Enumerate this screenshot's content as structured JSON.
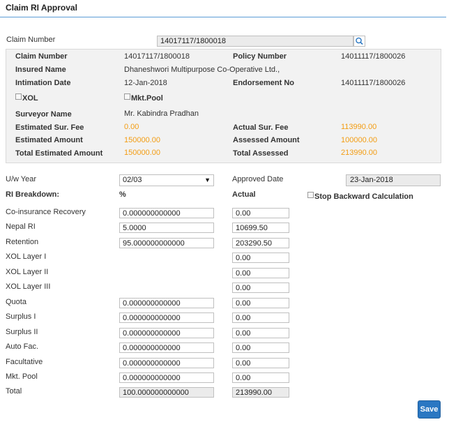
{
  "page": {
    "title": "Claim RI Approval"
  },
  "claim_search": {
    "label": "Claim Number",
    "value": "14017117/1800018"
  },
  "details": {
    "claim_number_label": "Claim Number",
    "claim_number": "14017117/1800018",
    "policy_number_label": "Policy Number",
    "policy_number": "14011117/1800026",
    "insured_name_label": "Insured Name",
    "insured_name": "Dhaneshwori Multipurpose Co-Operative Ltd.,",
    "intimation_date_label": "Intimation Date",
    "intimation_date": "12-Jan-2018",
    "endorsement_no_label": "Endorsement No",
    "endorsement_no": "14011117/1800026",
    "xol_label": "XOL",
    "mkt_pool_label": "Mkt.Pool",
    "surveyor_name_label": "Surveyor Name",
    "surveyor_name": "Mr. Kabindra Pradhan",
    "est_sur_fee_label": "Estimated Sur. Fee",
    "est_sur_fee": "0.00",
    "actual_sur_fee_label": "Actual Sur. Fee",
    "actual_sur_fee": "113990.00",
    "est_amount_label": "Estimated Amount",
    "est_amount": "150000.00",
    "assessed_amount_label": "Assessed Amount",
    "assessed_amount": "100000.00",
    "total_est_label": "Total Estimated Amount",
    "total_est": "150000.00",
    "total_assessed_label": "Total Assessed",
    "total_assessed": "213990.00"
  },
  "uw": {
    "year_label": "U/w Year",
    "year_value": "02/03",
    "approved_date_label": "Approved Date",
    "approved_date": "23-Jan-2018",
    "breakdown_label": "RI Breakdown:",
    "pct_header": "%",
    "actual_header": "Actual",
    "stop_backward_label": "Stop Backward Calculation"
  },
  "breakdown_rows": [
    {
      "label": "Co-insurance Recovery",
      "pct": "0.000000000000",
      "actual": "0.00"
    },
    {
      "label": "Nepal RI",
      "pct": "5.0000",
      "actual": "10699.50"
    },
    {
      "label": "Retention",
      "pct": "95.000000000000",
      "actual": "203290.50"
    },
    {
      "label": "XOL Layer I",
      "pct": "",
      "actual": "0.00"
    },
    {
      "label": "XOL Layer II",
      "pct": "",
      "actual": "0.00"
    },
    {
      "label": "XOL Layer III",
      "pct": "",
      "actual": "0.00"
    },
    {
      "label": "Quota",
      "pct": "0.000000000000",
      "actual": "0.00"
    },
    {
      "label": "Surplus I",
      "pct": "0.000000000000",
      "actual": "0.00"
    },
    {
      "label": "Surplus II",
      "pct": "0.000000000000",
      "actual": "0.00"
    },
    {
      "label": "Auto Fac.",
      "pct": "0.000000000000",
      "actual": "0.00"
    },
    {
      "label": "Facultative",
      "pct": "0.000000000000",
      "actual": "0.00"
    },
    {
      "label": "Mkt. Pool",
      "pct": "0.000000000000",
      "actual": "0.00"
    }
  ],
  "total_row": {
    "label": "Total",
    "pct": "100.000000000000",
    "actual": "213990.00"
  },
  "actions": {
    "save_label": "Save"
  }
}
